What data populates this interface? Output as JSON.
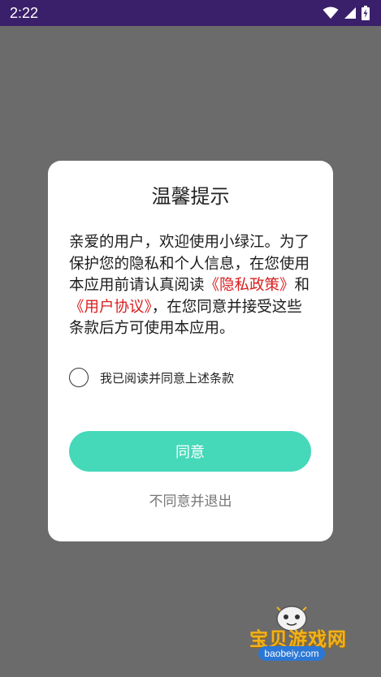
{
  "status_bar": {
    "time": "2:22",
    "icons": [
      "wifi-icon",
      "signal-icon",
      "battery-charging-icon"
    ]
  },
  "dialog": {
    "title": "温馨提示",
    "body": {
      "intro": "亲爱的用户，欢迎使用小绿江。为了保护您的隐私和个人信息，在您使用本应用前请认真阅读",
      "privacy_link": "《隐私政策》",
      "conjunction": "和",
      "agreement_link": "《用户协议》",
      "outro": "，在您同意并接受这些条款后方可使用本应用。"
    },
    "checkbox_label": "我已阅读并同意上述条款",
    "checkbox_checked": false,
    "agree_button": "同意",
    "decline_link": "不同意并退出"
  },
  "watermark": {
    "text": "宝贝游戏网",
    "url": "baobeiy.com"
  },
  "colors": {
    "status_bar": "#3a1f6a",
    "backdrop": "#6b6b6b",
    "accent": "#45d8b9",
    "link": "#d81e1e"
  }
}
